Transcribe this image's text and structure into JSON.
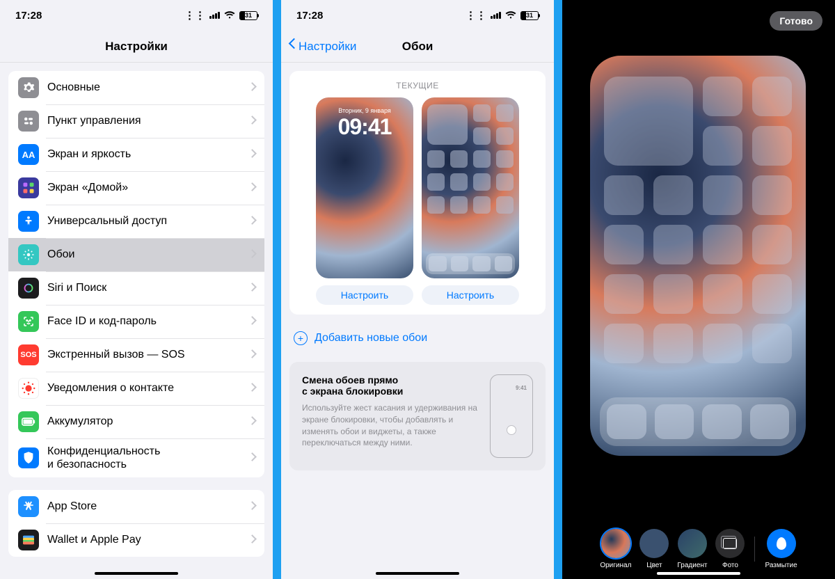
{
  "status": {
    "time": "17:28",
    "battery_pct": "31"
  },
  "panel1": {
    "title": "Настройки",
    "groups": [
      [
        {
          "id": "general",
          "label": "Основные",
          "color": "ic-general"
        },
        {
          "id": "control",
          "label": "Пункт управления",
          "color": "ic-control"
        },
        {
          "id": "display",
          "label": "Экран и яркость",
          "color": "ic-display"
        },
        {
          "id": "home",
          "label": "Экран «Домой»",
          "color": "ic-home"
        },
        {
          "id": "access",
          "label": "Универсальный доступ",
          "color": "ic-access"
        },
        {
          "id": "wall",
          "label": "Обои",
          "color": "ic-wall",
          "selected": true
        },
        {
          "id": "siri",
          "label": "Siri и Поиск",
          "color": "ic-siri"
        },
        {
          "id": "face",
          "label": "Face ID и код-пароль",
          "color": "ic-face"
        },
        {
          "id": "sos",
          "label": "Экстренный вызов — SOS",
          "color": "ic-sos"
        },
        {
          "id": "exposure",
          "label": "Уведомления о контакте",
          "color": "ic-exposure"
        },
        {
          "id": "battery",
          "label": "Аккумулятор",
          "color": "ic-battery"
        },
        {
          "id": "privacy",
          "label": "Конфиденциальность\nи безопасность",
          "color": "ic-privacy"
        }
      ],
      [
        {
          "id": "appstore",
          "label": "App Store",
          "color": "ic-appstore"
        },
        {
          "id": "wallet",
          "label": "Wallet и Apple Pay",
          "color": "ic-wallet"
        }
      ]
    ]
  },
  "panel2": {
    "back": "Настройки",
    "title": "Обои",
    "current_caption": "ТЕКУЩИЕ",
    "customize": "Настроить",
    "add_new": "Добавить новые обои",
    "lock_date": "Вторник, 9 января",
    "lock_time": "09:41",
    "tip_title": "Смена обоев прямо\nс экрана блокировки",
    "tip_body": "Используйте жест касания и удерживания на экране блокировки, чтобы добавлять и изменять обои и виджеты, а также переключаться между ними.",
    "tip_time": "9:41"
  },
  "panel3": {
    "done": "Готово",
    "toolbar": [
      {
        "id": "original",
        "label": "Оригинал",
        "cls": "c-orig",
        "active": true
      },
      {
        "id": "color",
        "label": "Цвет",
        "cls": "c-color"
      },
      {
        "id": "gradient",
        "label": "Градиент",
        "cls": "c-grad"
      },
      {
        "id": "photo",
        "label": "Фото",
        "cls": "c-photo"
      }
    ],
    "blur": {
      "label": "Размытие",
      "cls": "c-blur"
    }
  }
}
